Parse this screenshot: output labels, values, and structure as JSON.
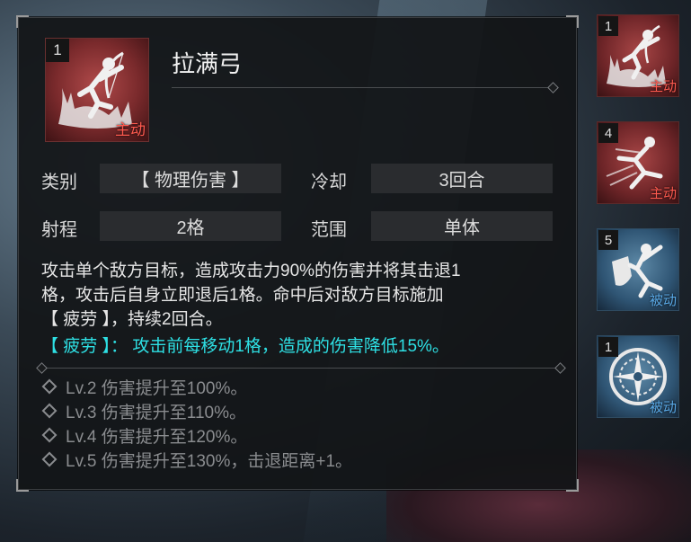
{
  "skill": {
    "level": "1",
    "type_badge": "主动",
    "name": "拉满弓"
  },
  "stats": {
    "category_label": "类别",
    "category_value": "【 物理伤害 】",
    "cooldown_label": "冷却",
    "cooldown_value": "3回合",
    "range_label": "射程",
    "range_value": "2格",
    "area_label": "范围",
    "area_value": "单体"
  },
  "description": {
    "line1": "攻击单个敌方目标，造成攻击力90%的伤害并将其击退1",
    "line2": "格，攻击后自身立即退后1格。命中后对敌方目标施加",
    "line3": "【 疲劳 】，持续2回合。",
    "effect": "【 疲劳 】： 攻击前每移动1格，造成的伤害降低15%。"
  },
  "upgrades": [
    "Lv.2 伤害提升至100%。",
    "Lv.3 伤害提升至110%。",
    "Lv.4 伤害提升至120%。",
    "Lv.5 伤害提升至130%，击退距离+1。"
  ],
  "skill_list": [
    {
      "level": "1",
      "type": "主动",
      "icon": "archer-icon"
    },
    {
      "level": "4",
      "type": "主动",
      "icon": "dash-strike-icon"
    },
    {
      "level": "5",
      "type": "被动",
      "icon": "shield-warrior-icon"
    },
    {
      "level": "1",
      "type": "被动",
      "icon": "compass-emblem-icon"
    }
  ],
  "colors": {
    "active": "#ff5a4f",
    "passive": "#5aaae8",
    "effect_keyword": "#2ee0e4"
  }
}
